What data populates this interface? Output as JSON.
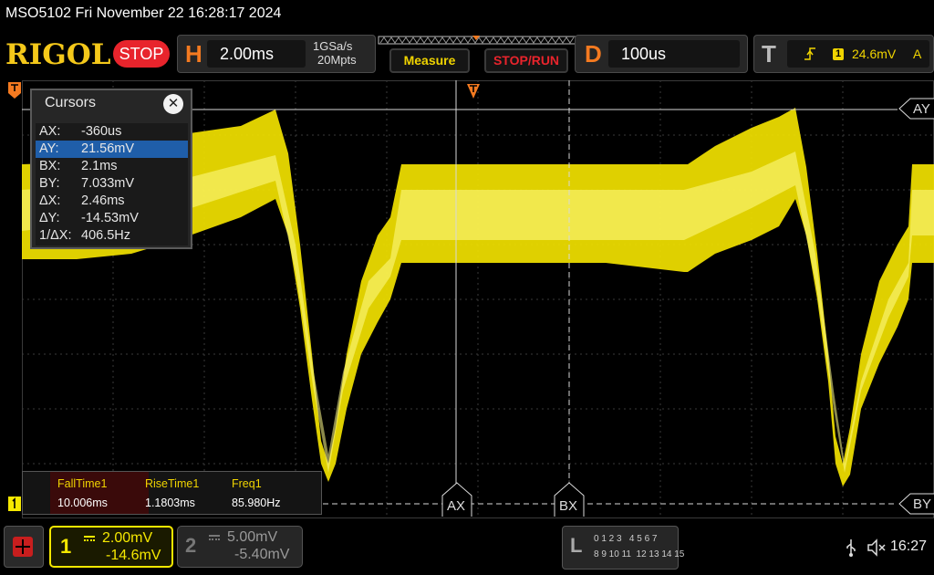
{
  "title_bar": {
    "text": "MSO5102  Fri November 22 16:28:17 2024"
  },
  "header": {
    "logo": "RIGOL",
    "run_state": "STOP",
    "horizontal": {
      "key": "H",
      "timebase": "2.00ms",
      "sample_rate": "1GSa/s",
      "memory_depth": "20Mpts"
    },
    "measure_button": "Measure",
    "stop_run_button": "STOP/RUN",
    "delay": {
      "key": "D",
      "value": "100us"
    },
    "trigger": {
      "key": "T",
      "level": "24.6mV",
      "mode": "A",
      "source": "1"
    }
  },
  "cursors_panel": {
    "title": "Cursors",
    "rows": [
      {
        "label": "AX:",
        "value": "-360us"
      },
      {
        "label": "AY:",
        "value": "21.56mV"
      },
      {
        "label": "BX:",
        "value": "2.1ms"
      },
      {
        "label": "BY:",
        "value": "7.033mV"
      },
      {
        "label": "ΔX:",
        "value": "2.46ms"
      },
      {
        "label": "ΔY:",
        "value": "-14.53mV"
      },
      {
        "label": "1/ΔX:",
        "value": "406.5Hz"
      }
    ]
  },
  "cursor_tags": {
    "ax": "AX",
    "bx": "BX",
    "ay": "AY",
    "by": "BY"
  },
  "measurements": [
    {
      "label": "FallTime1",
      "value": "10.006ms"
    },
    {
      "label": "RiseTime1",
      "value": "1.1803ms"
    },
    {
      "label": "Freq1",
      "value": "85.980Hz"
    }
  ],
  "channels": [
    {
      "number": "1",
      "scale": "2.00mV",
      "offset": "-14.6mV",
      "color": "#f5e800"
    },
    {
      "number": "2",
      "scale": "5.00mV",
      "offset": "-5.40mV",
      "color": "#2b8ac8"
    }
  ],
  "logic": {
    "key": "L",
    "row1": "0 1 2 3   4 5 6 7",
    "row2": "8 9 10 11  12 13 14 15"
  },
  "status": {
    "time": "16:27"
  },
  "colors": {
    "trace": "#ffee00",
    "accent": "#f47a20",
    "stop": "#e8242c"
  }
}
